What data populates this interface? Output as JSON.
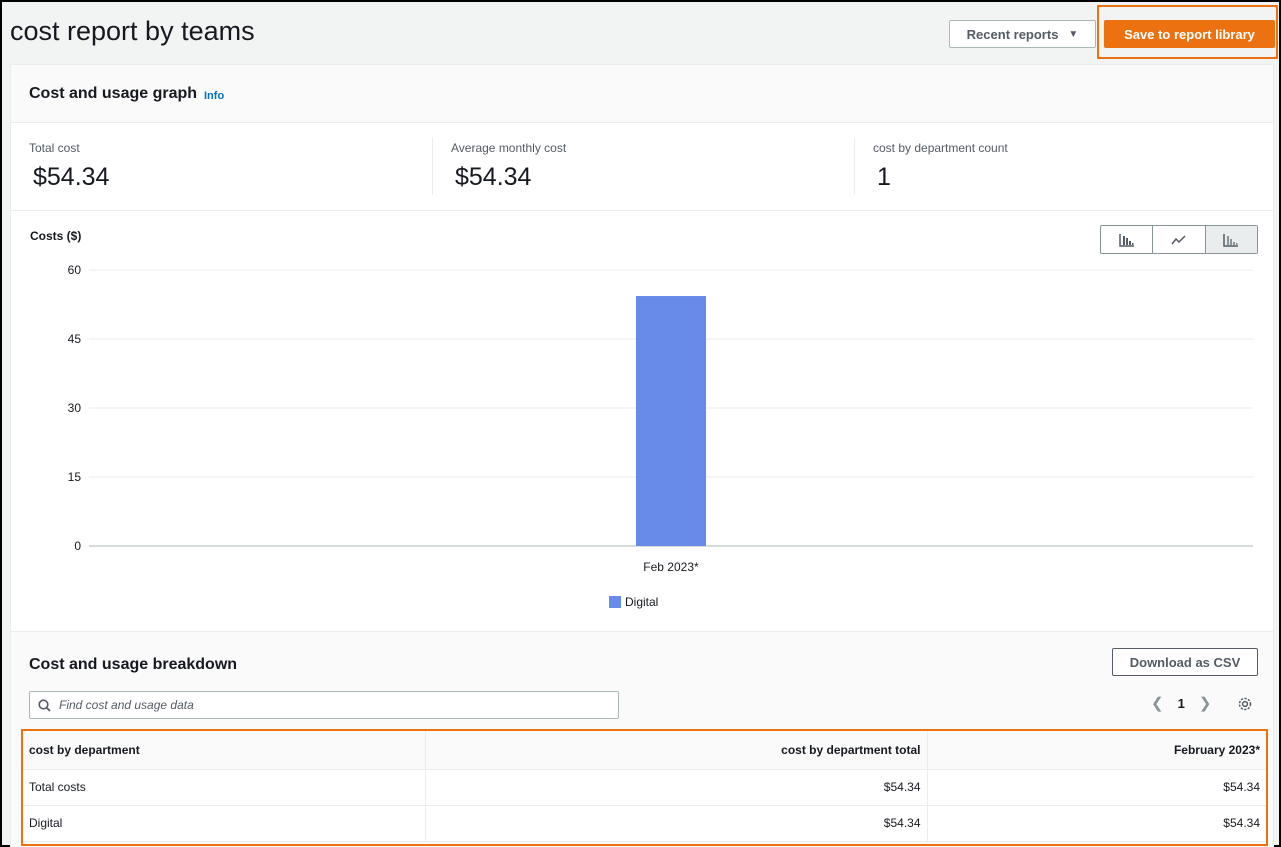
{
  "header": {
    "title": "cost report by teams",
    "recent_reports_label": "Recent reports",
    "save_label": "Save to report library"
  },
  "graph_panel": {
    "title": "Cost and usage graph",
    "info_label": "Info",
    "stats": [
      {
        "label": "Total cost",
        "value": "$54.34"
      },
      {
        "label": "Average monthly cost",
        "value": "$54.34"
      },
      {
        "label": "cost by department count",
        "value": "1"
      }
    ],
    "chart_toggle_icons": [
      "bar-chart-icon",
      "line-chart-icon",
      "stacked-bar-chart-icon"
    ],
    "selected_chart_style": "stacked-bar-chart-icon"
  },
  "chart_data": {
    "type": "bar",
    "ylabel": "Costs ($)",
    "categories": [
      "Feb 2023*"
    ],
    "series": [
      {
        "name": "Digital",
        "values": [
          54.34
        ],
        "color": "#688ae8"
      }
    ],
    "yticks": [
      0,
      15,
      30,
      45,
      60
    ],
    "ylim": [
      0,
      60
    ],
    "grid": true,
    "legend_position": "bottom"
  },
  "breakdown": {
    "title": "Cost and usage breakdown",
    "download_label": "Download as CSV",
    "search_placeholder": "Find cost and usage data",
    "page": "1",
    "columns": [
      "cost by department",
      "cost by department total",
      "February 2023*"
    ],
    "rows": [
      [
        "Total costs",
        "$54.34",
        "$54.34"
      ],
      [
        "Digital",
        "$54.34",
        "$54.34"
      ]
    ]
  }
}
